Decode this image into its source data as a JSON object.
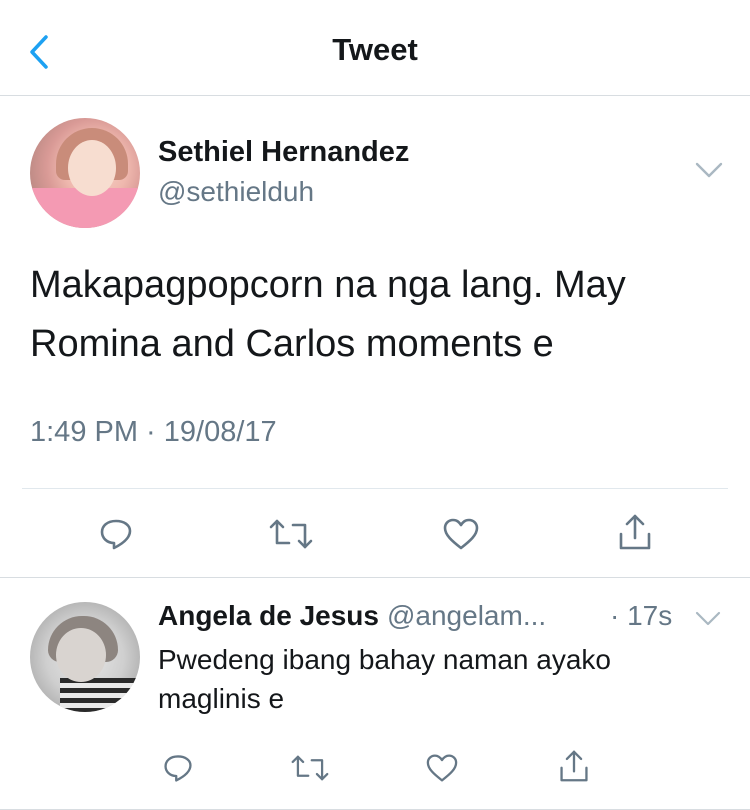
{
  "nav": {
    "title": "Tweet",
    "back_icon": "chevron-left-icon",
    "accent": "#1da1f2"
  },
  "tweet": {
    "display_name": "Sethiel Hernandez",
    "handle": "@sethielduh",
    "text_line1": "Makapagpopcorn na nga lang. May",
    "text_line2": "Romina and Carlos moments e",
    "timestamp": "1:49 PM · 19/08/17",
    "actions": [
      "reply-icon",
      "retweet-icon",
      "like-icon",
      "share-icon"
    ]
  },
  "reply": {
    "display_name": "Angela de Jesus",
    "handle": "@angelam...",
    "time": "· 17s",
    "text_line1": "Pwedeng ibang bahay naman ayako",
    "text_line2": "maglinis e",
    "actions": [
      "reply-icon",
      "retweet-icon",
      "like-icon",
      "share-icon"
    ]
  },
  "colors": {
    "text": "#14171a",
    "secondary": "#657786",
    "divider": "#d8dde1",
    "icon": "#657786"
  }
}
